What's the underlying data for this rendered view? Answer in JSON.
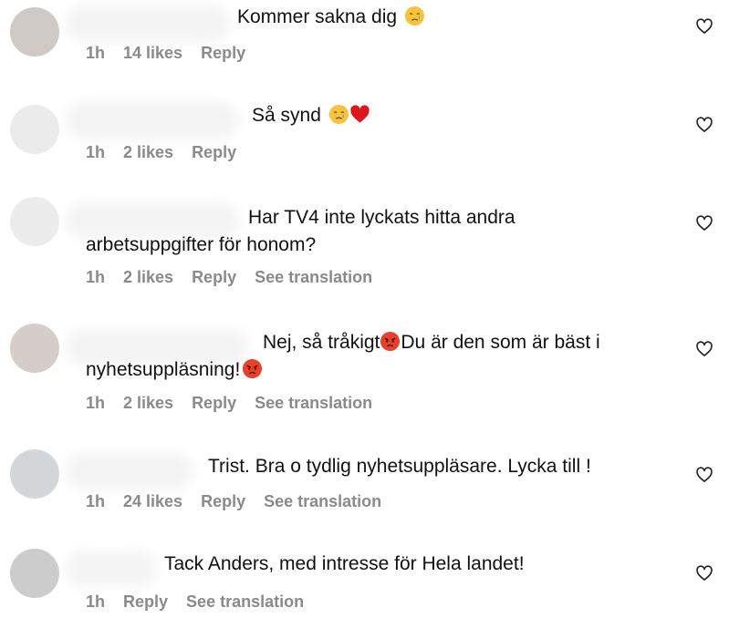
{
  "colors": {
    "text": "#111111",
    "meta": "#8a8a8a",
    "heart_outline": "#262626",
    "emoji_yellow": "#f6c33b",
    "emoji_tear": "#5aa9e6",
    "emoji_angry": "#e8402a",
    "heart_red": "#e0161b"
  },
  "comments": [
    {
      "text": "Kommer sakna dig",
      "emoji_after": [
        "crying-face-icon"
      ],
      "time": "1h",
      "likes": "14 likes",
      "reply": "Reply",
      "translation": ""
    },
    {
      "text": "Så synd",
      "emoji_after": [
        "crying-face-icon",
        "red-heart-icon"
      ],
      "time": "1h",
      "likes": "2 likes",
      "reply": "Reply",
      "translation": ""
    },
    {
      "text_line1": "Har TV4 inte lyckats hitta andra",
      "text_line2": "arbetsuppgifter för honom?",
      "time": "1h",
      "likes": "2 likes",
      "reply": "Reply",
      "translation": "See translation"
    },
    {
      "text_line1a": "Nej, så tråkigt",
      "text_line1b": "Du är den som är bäst i",
      "text_line2": "nyhetsuppläsning!",
      "emoji_inline": "angry-face-icon",
      "time": "1h",
      "likes": "2 likes",
      "reply": "Reply",
      "translation": "See translation"
    },
    {
      "text": "Trist. Bra o tydlig nyhetsuppläsare. Lycka till !",
      "time": "1h",
      "likes": "24 likes",
      "reply": "Reply",
      "translation": "See translation"
    },
    {
      "text": "Tack Anders, med intresse för Hela landet!",
      "time": "1h",
      "likes": "",
      "reply": "Reply",
      "translation": "See translation"
    }
  ],
  "icons": {
    "like": "heart-outline-icon",
    "avatar": "avatar"
  }
}
